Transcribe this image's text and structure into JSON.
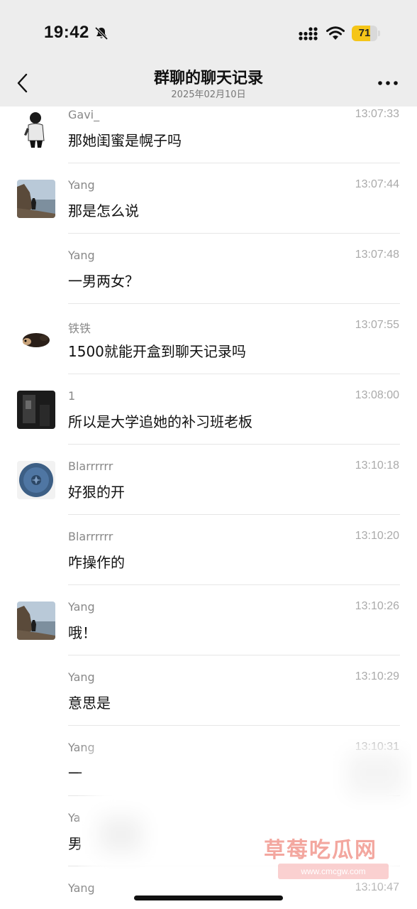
{
  "status": {
    "time": "19:42",
    "battery": "71",
    "battery_level": 0.71
  },
  "header": {
    "title": "群聊的聊天记录",
    "date": "2025年02月10日"
  },
  "messages": [
    {
      "name": "Gavi_",
      "time": "13:07:33",
      "text": "那她闺蜜是幌子吗",
      "avatar": "man-photo-avatar"
    },
    {
      "name": "Yang",
      "time": "13:07:44",
      "text": "那是怎么说",
      "avatar": "coast-photo-avatar"
    },
    {
      "name": "Yang",
      "time": "13:07:48",
      "text": "一男两女？",
      "avatar": ""
    },
    {
      "name": "铁铁",
      "time": "13:07:55",
      "text": "1500就能开盒到聊天记录吗",
      "avatar": "dog-avatar"
    },
    {
      "name": "1",
      "time": "13:08:00",
      "text": "所以是大学追她的补习班老板",
      "avatar": "dark-photo-avatar"
    },
    {
      "name": "Blarrrrrr",
      "time": "13:10:18",
      "text": "好狠的开",
      "avatar": "blueberry-avatar"
    },
    {
      "name": "Blarrrrrr",
      "time": "13:10:20",
      "text": "咋操作的",
      "avatar": ""
    },
    {
      "name": "Yang",
      "time": "13:10:26",
      "text": "哦！",
      "avatar": "coast-photo-avatar"
    },
    {
      "name": "Yang",
      "time": "13:10:29",
      "text": "意思是",
      "avatar": ""
    },
    {
      "name": "Yang",
      "time": "13:10:31",
      "text": "一",
      "avatar": ""
    },
    {
      "name": "Ya",
      "time": "",
      "text": "男",
      "avatar": ""
    },
    {
      "name": "Yang",
      "time": "13:10:47",
      "text": "",
      "avatar": ""
    }
  ],
  "watermark": {
    "text": "草莓吃瓜网",
    "url": "www.cmcgw.com"
  }
}
